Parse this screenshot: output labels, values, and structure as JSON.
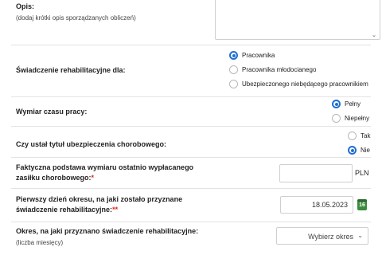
{
  "description": {
    "label": "Opis:",
    "hint": "(dodaj krótki opis sporządzanych obliczeń)",
    "value": ""
  },
  "rehab_for": {
    "label": "Świadczenie rehabilitacyjne dla:",
    "options": [
      "Pracownika",
      "Pracownika młodocianego",
      "Ubezpieczonego niebędącego pracownikiem"
    ],
    "selected": "Pracownika"
  },
  "work_time": {
    "label": "Wymiar czasu pracy:",
    "options": [
      "Pełny",
      "Niepełny"
    ],
    "selected": "Pełny"
  },
  "sickness_title": {
    "label": "Czy ustał tytuł ubezpieczenia chorobowego:",
    "options": [
      "Tak",
      "Nie"
    ],
    "selected": "Nie"
  },
  "base": {
    "label_line1": "Faktyczna podstawa wymiaru ostatnio wypłacanego",
    "label_line2": "zasiłku chorobowego:",
    "required_mark": "*",
    "value": "",
    "unit": "PLN"
  },
  "first_day": {
    "label_line1": "Pierwszy dzień okresu, na jaki zostało przyznane",
    "label_line2": "świadczenie rehabilitacyjne:",
    "required_mark": "**",
    "value": "18.05.2023",
    "calendar_day": "16"
  },
  "period": {
    "label": "Okres, na jaki przyznano świadczenie rehabilitacyjne:",
    "hint": "(liczba miesięcy)",
    "value": "Wybierz okres"
  }
}
